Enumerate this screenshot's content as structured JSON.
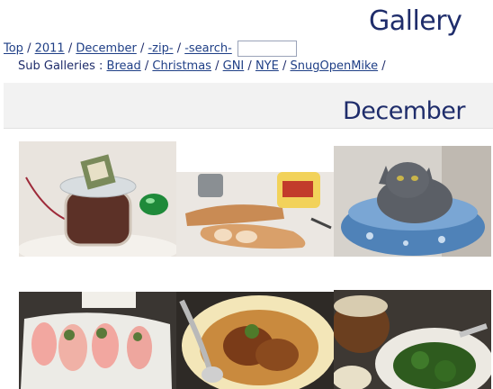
{
  "page_title": "Gallery",
  "breadcrumb": {
    "items": [
      "Top",
      "2011",
      "December",
      "-zip-",
      "-search-"
    ],
    "separator": "/",
    "search_value": ""
  },
  "sub_galleries": {
    "label": "Sub Galleries :",
    "items": [
      "Bread",
      "Christmas",
      "GNI",
      "NYE",
      "SnugOpenMike"
    ],
    "separator": "/"
  },
  "section_title": "December",
  "thumbnails": [
    {
      "subject": "jar-ornament"
    },
    {
      "subject": "bread-loaves"
    },
    {
      "subject": "cat-in-bed"
    },
    {
      "subject": "sashimi-plate"
    },
    {
      "subject": "roast-quail"
    },
    {
      "subject": "rice-and-greens"
    }
  ],
  "colors": {
    "link": "#1f3f86",
    "title": "#1f2d6b",
    "band": "#f2f2f2"
  }
}
